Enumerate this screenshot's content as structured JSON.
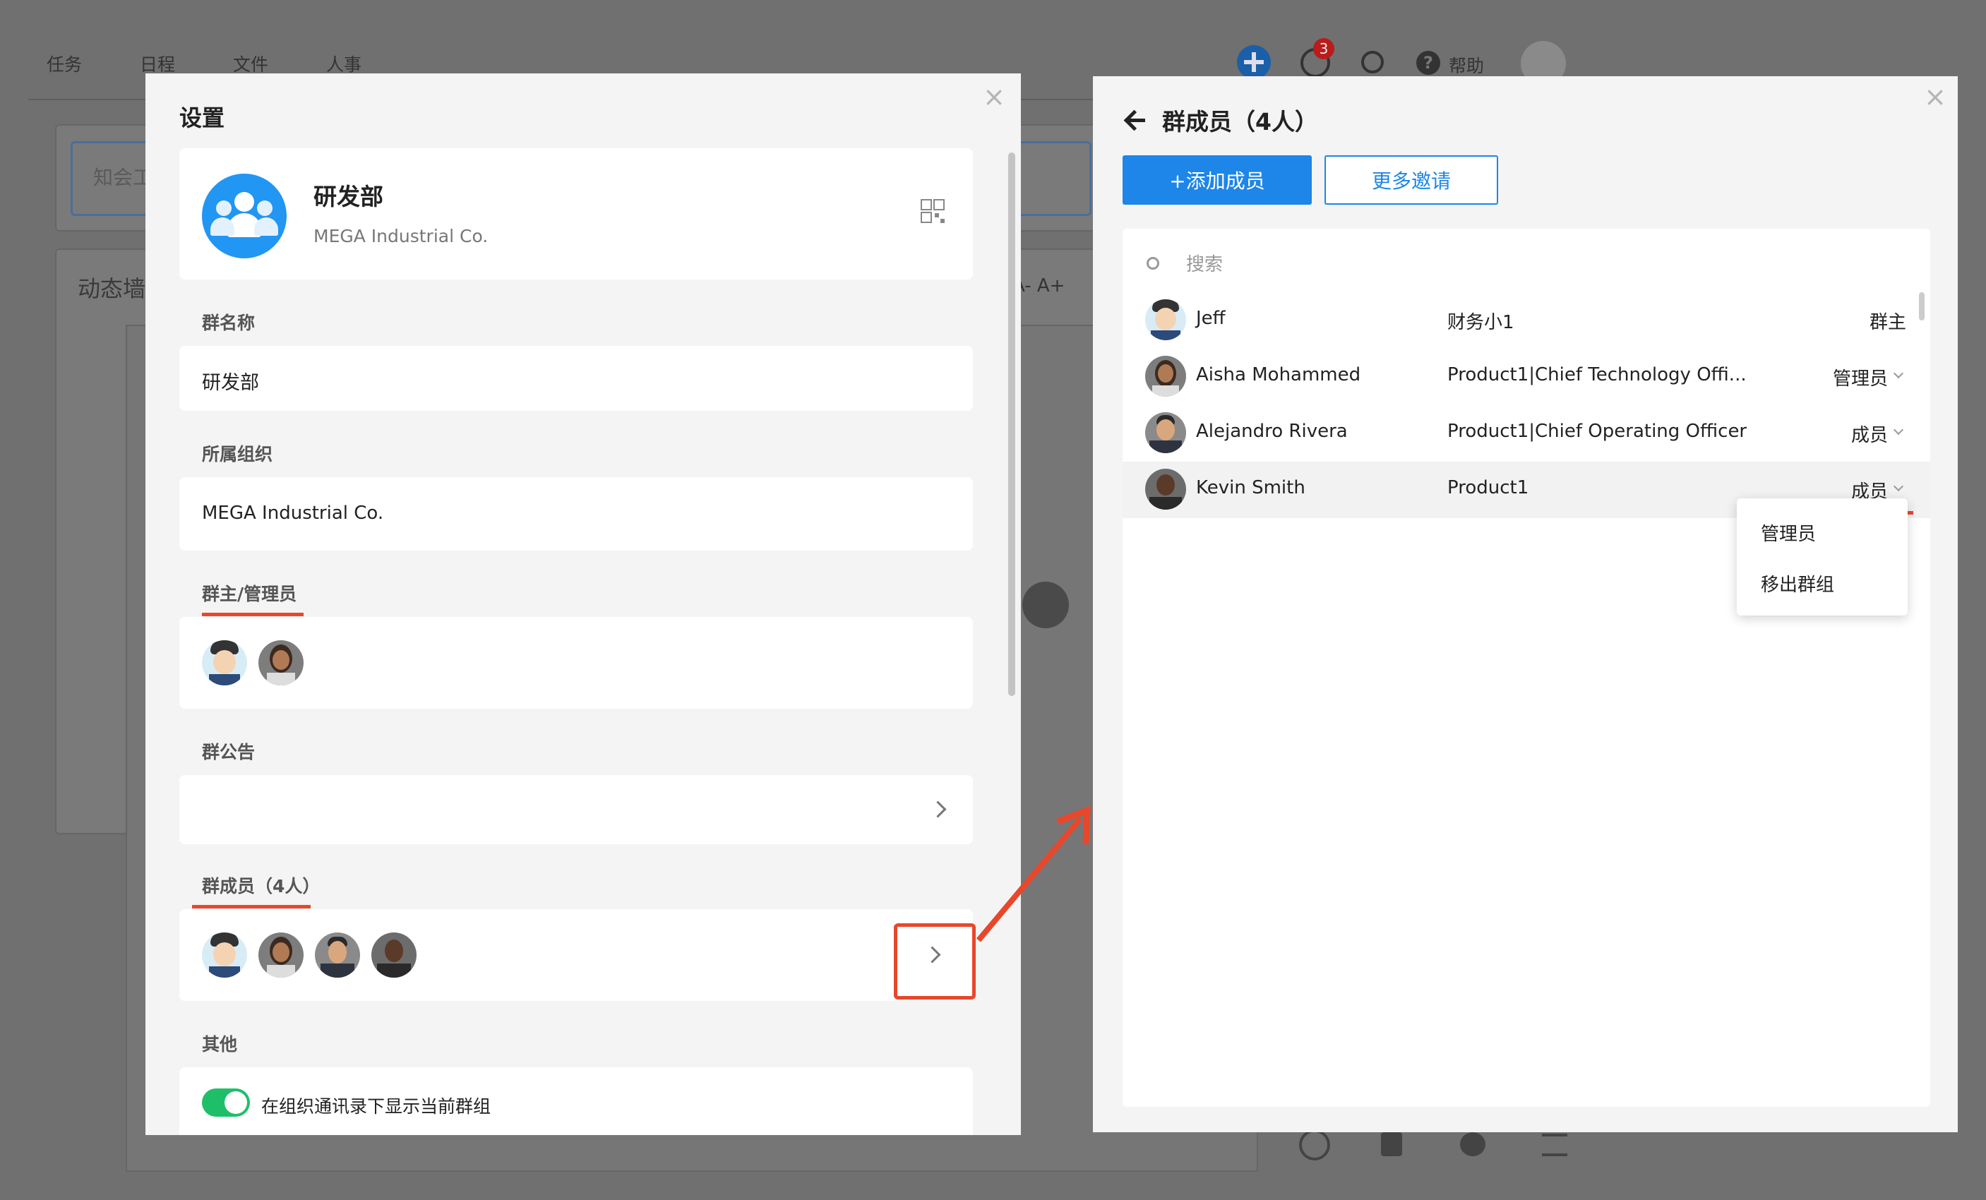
{
  "background_app": {
    "nav_tabs": [
      "任务",
      "日程",
      "文件",
      "人事"
    ],
    "header_help": "帮助",
    "notification_count": "3",
    "search_placeholder_partial": "知会工",
    "wall_title_partial": "动态墙",
    "font_controls": "A- A+"
  },
  "settings_dialog": {
    "title": "设置",
    "group_card": {
      "name": "研发部",
      "org": "MEGA Industrial Co."
    },
    "group_name_label": "群名称",
    "group_name_value": "研发部",
    "org_label": "所属组织",
    "org_value": "MEGA Industrial Co.",
    "admins_label": "群主/管理员",
    "announcement_label": "群公告",
    "members_label": "群成员（4人）",
    "other_label": "其他",
    "toggle_label": "在组织通讯录下显示当前群组",
    "toggle_on": true
  },
  "members_panel": {
    "title": "群成员（4人）",
    "add_button": "+添加成员",
    "invite_button": "更多邀请",
    "search_placeholder": "搜索",
    "members": [
      {
        "name": "Jeff",
        "dept": "财务小1",
        "role": "群主"
      },
      {
        "name": "Aisha Mohammed",
        "dept": "Product1|Chief Technology Offi...",
        "role": "管理员"
      },
      {
        "name": "Alejandro Rivera",
        "dept": "Product1|Chief Operating Officer",
        "role": "成员"
      },
      {
        "name": "Kevin Smith",
        "dept": "Product1",
        "role": "成员"
      }
    ],
    "role_menu": [
      "管理员",
      "移出群组"
    ]
  },
  "colors": {
    "accent": "#1d86e8",
    "highlight": "#e8472c",
    "toggle": "#1fbf6a"
  }
}
